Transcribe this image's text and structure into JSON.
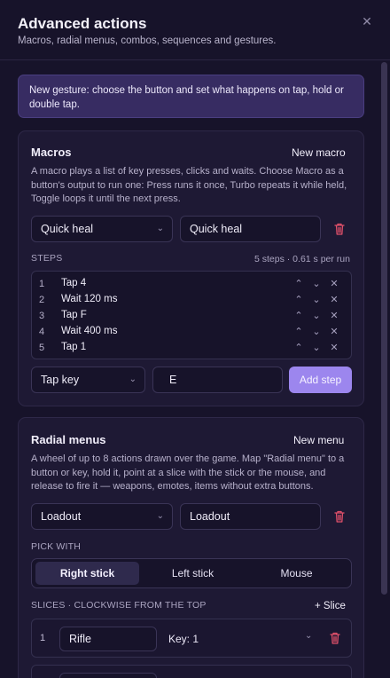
{
  "header": {
    "title": "Advanced actions",
    "subtitle": "Macros, radial menus, combos, sequences and gestures.",
    "close_glyph": "✕"
  },
  "banner": {
    "text": "New gesture: choose the button and set what happens on tap, hold or double tap."
  },
  "macros": {
    "title": "Macros",
    "new_label": "New macro",
    "description": "A macro plays a list of key presses, clicks and waits. Choose Macro as a button's output to run one: Press runs it once, Turbo repeats it while held, Toggle loops it until the next press.",
    "selected_macro": "Quick heal",
    "name_value": "Quick heal",
    "steps_label": "STEPS",
    "steps_meta": "5 steps · 0.61 s per run",
    "steps": [
      {
        "num": "1",
        "label": "Tap 4"
      },
      {
        "num": "2",
        "label": "Wait 120 ms"
      },
      {
        "num": "3",
        "label": "Tap F"
      },
      {
        "num": "4",
        "label": "Wait 400 ms"
      },
      {
        "num": "5",
        "label": "Tap 1"
      }
    ],
    "step_type": "Tap key",
    "step_value": "E",
    "add_step_label": "Add step"
  },
  "radial": {
    "title": "Radial menus",
    "new_label": "New menu",
    "description": "A wheel of up to 8 actions drawn over the game. Map \"Radial menu\" to a button or key, hold it, point at a slice with the stick or the mouse, and release to fire it — weapons, emotes, items without extra buttons.",
    "selected_menu": "Loadout",
    "name_value": "Loadout",
    "pick_with_label": "PICK WITH",
    "pick_options": [
      "Right stick",
      "Left stick",
      "Mouse"
    ],
    "pick_selected": "Right stick",
    "slices_label": "SLICES · CLOCKWISE FROM THE TOP",
    "add_slice_label": "+ Slice",
    "slices": [
      {
        "num": "1",
        "name": "Rifle",
        "key": "Key: 1"
      }
    ]
  },
  "icons": {
    "close": "close-icon",
    "chevron": "chevron-down-icon",
    "trash": "trash-icon",
    "up": "arrow-up-icon",
    "down": "arrow-down-icon",
    "remove": "remove-icon"
  },
  "colors": {
    "background": "#17132a",
    "card": "#1e1934",
    "accent": "#9c86ee",
    "banner": "#372c62",
    "danger": "#e0506a"
  }
}
